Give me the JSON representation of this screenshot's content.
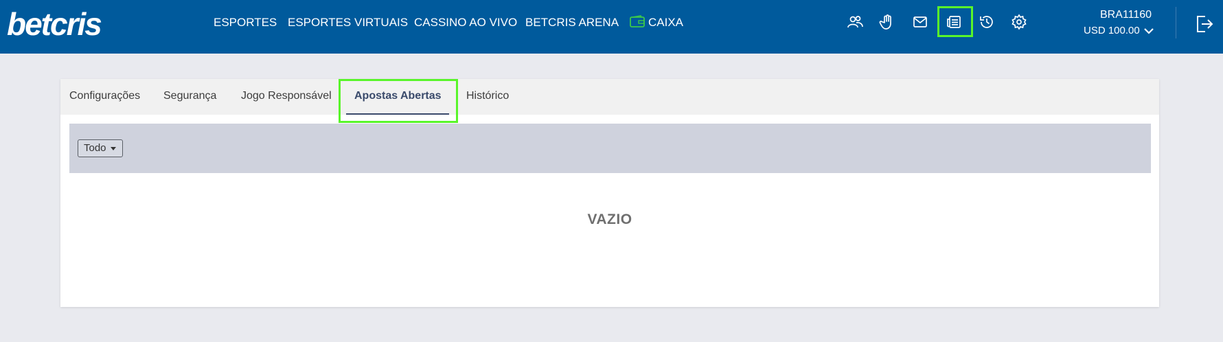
{
  "brand": {
    "logo_text": "betcris",
    "primary_color": "#005a9c",
    "highlight_color": "#59f52a"
  },
  "nav": {
    "items": [
      "ESPORTES",
      "ESPORTES VIRTUAIS",
      "CASSINO AO VIVO",
      "BETCRIS ARENA",
      "CAIXA"
    ],
    "caixa_icon": "wallet-icon"
  },
  "header_icons": [
    "users-icon",
    "hand-stop-icon",
    "mail-icon",
    "open-bets-icon",
    "history-icon",
    "settings-icon"
  ],
  "account": {
    "user_id": "BRA11160",
    "balance": "USD 100.00"
  },
  "tabs": [
    {
      "label": "Configurações",
      "active": false
    },
    {
      "label": "Segurança",
      "active": false
    },
    {
      "label": "Jogo Responsável",
      "active": false
    },
    {
      "label": "Apostas Abertas",
      "active": true
    },
    {
      "label": "Histórico",
      "active": false
    }
  ],
  "filter": {
    "selected": "Todo"
  },
  "empty_state": {
    "message": "VAZIO"
  }
}
